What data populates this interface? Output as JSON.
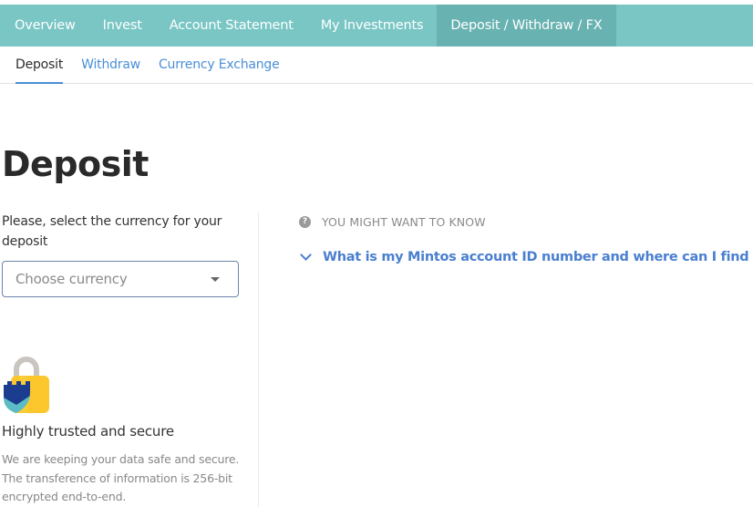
{
  "topnav": {
    "items": [
      {
        "label": "Overview",
        "active": false
      },
      {
        "label": "Invest",
        "active": false
      },
      {
        "label": "Account Statement",
        "active": false
      },
      {
        "label": "My Investments",
        "active": false
      },
      {
        "label": "Deposit / Withdraw / FX",
        "active": true
      }
    ]
  },
  "subnav": {
    "tabs": [
      {
        "label": "Deposit",
        "active": true
      },
      {
        "label": "Withdraw",
        "active": false
      },
      {
        "label": "Currency Exchange",
        "active": false
      }
    ]
  },
  "page": {
    "title": "Deposit",
    "prompt": "Please, select the currency for your deposit",
    "currency_select": {
      "placeholder": "Choose currency",
      "value": ""
    }
  },
  "security": {
    "icon": "lock-shield-icon",
    "title": "Highly trusted and secure",
    "text": "We are keeping your data safe and secure. The transference of information is 256-bit encrypted end-to-end."
  },
  "info": {
    "header_icon": "question-circle-icon",
    "header": "YOU MIGHT WANT TO KNOW",
    "faq": [
      {
        "question": "What is my Mintos account ID number and where can I find it?",
        "expanded": false
      }
    ]
  },
  "colors": {
    "nav_bg": "#79c6c5",
    "nav_active_bg": "#68b2b1",
    "link_blue": "#4a8fd6",
    "faq_blue": "#4a7fd0"
  }
}
